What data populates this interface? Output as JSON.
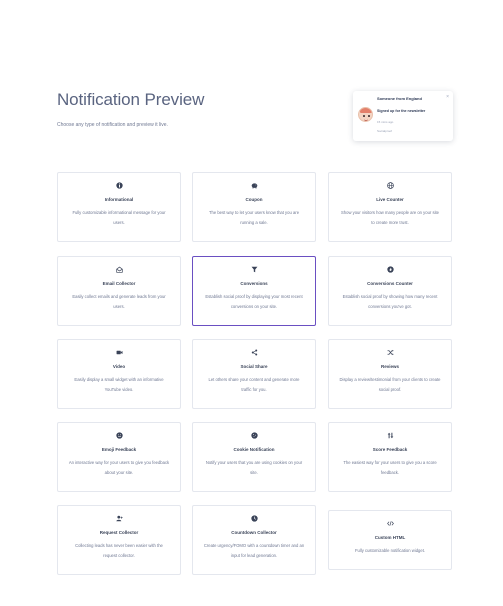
{
  "page": {
    "title": "Notification Preview",
    "subtitle": "Choose any type of notification and preview it live."
  },
  "preview": {
    "close_symbol": "×",
    "from": "Someone from England",
    "action": "Signed up for the newsletter",
    "time": "15 mins ago",
    "brand": "Socialproof"
  },
  "cards": [
    {
      "name": "Informational",
      "icon": "info-icon",
      "desc": "Fully customizable informational message for your users."
    },
    {
      "name": "Coupon",
      "icon": "piggy-bank-icon",
      "desc": "The best way to let your users know that you are running a sale."
    },
    {
      "name": "Live Counter",
      "icon": "globe-icon",
      "desc": "Show your visitors how many people are on your site to create more trust."
    },
    {
      "name": "Email Collector",
      "icon": "envelope-open-icon",
      "desc": "Easily collect emails and generate leads from your users."
    },
    {
      "name": "Conversions",
      "icon": "funnel-icon",
      "desc": "Establish social proof by displaying your most recent conversions on your site."
    },
    {
      "name": "Conversions Counter",
      "icon": "fire-icon",
      "desc": "Establish social proof by showing how many recent conversions you've got."
    },
    {
      "name": "Video",
      "icon": "video-icon",
      "desc": "Easily display a small widget with an informative YouTube video."
    },
    {
      "name": "Social Share",
      "icon": "share-icon",
      "desc": "Let others share your content and generate more traffic for you."
    },
    {
      "name": "Reviews",
      "icon": "random-icon",
      "desc": "Display a review/testimonial from your clients to create social proof."
    },
    {
      "name": "Emoji Feedback",
      "icon": "smile-icon",
      "desc": "An interactive way for your users to give you feedback about your site."
    },
    {
      "name": "Cookie Notification",
      "icon": "cookie-icon",
      "desc": "Notify your users that you are using cookies on your site."
    },
    {
      "name": "Score Feedback",
      "icon": "sort-arrows-icon",
      "desc": "The easiest way for your users to give you a score feedback."
    },
    {
      "name": "Request Collector",
      "icon": "user-plus-icon",
      "desc": "Collecting leads has never been easier with the request collector."
    },
    {
      "name": "Countdown Collector",
      "icon": "clock-icon",
      "desc": "Create urgency/FOMO with a countdown timer and an input for lead generation."
    },
    {
      "name": "Custom HTML",
      "icon": "code-icon",
      "desc": "Fully customizable notification widget."
    }
  ],
  "selected_card": "Conversions",
  "colors": {
    "text": "#3a4358",
    "muted": "#6f7892",
    "border": "#e4e7ee",
    "selected_border": "#6a4fc2"
  }
}
